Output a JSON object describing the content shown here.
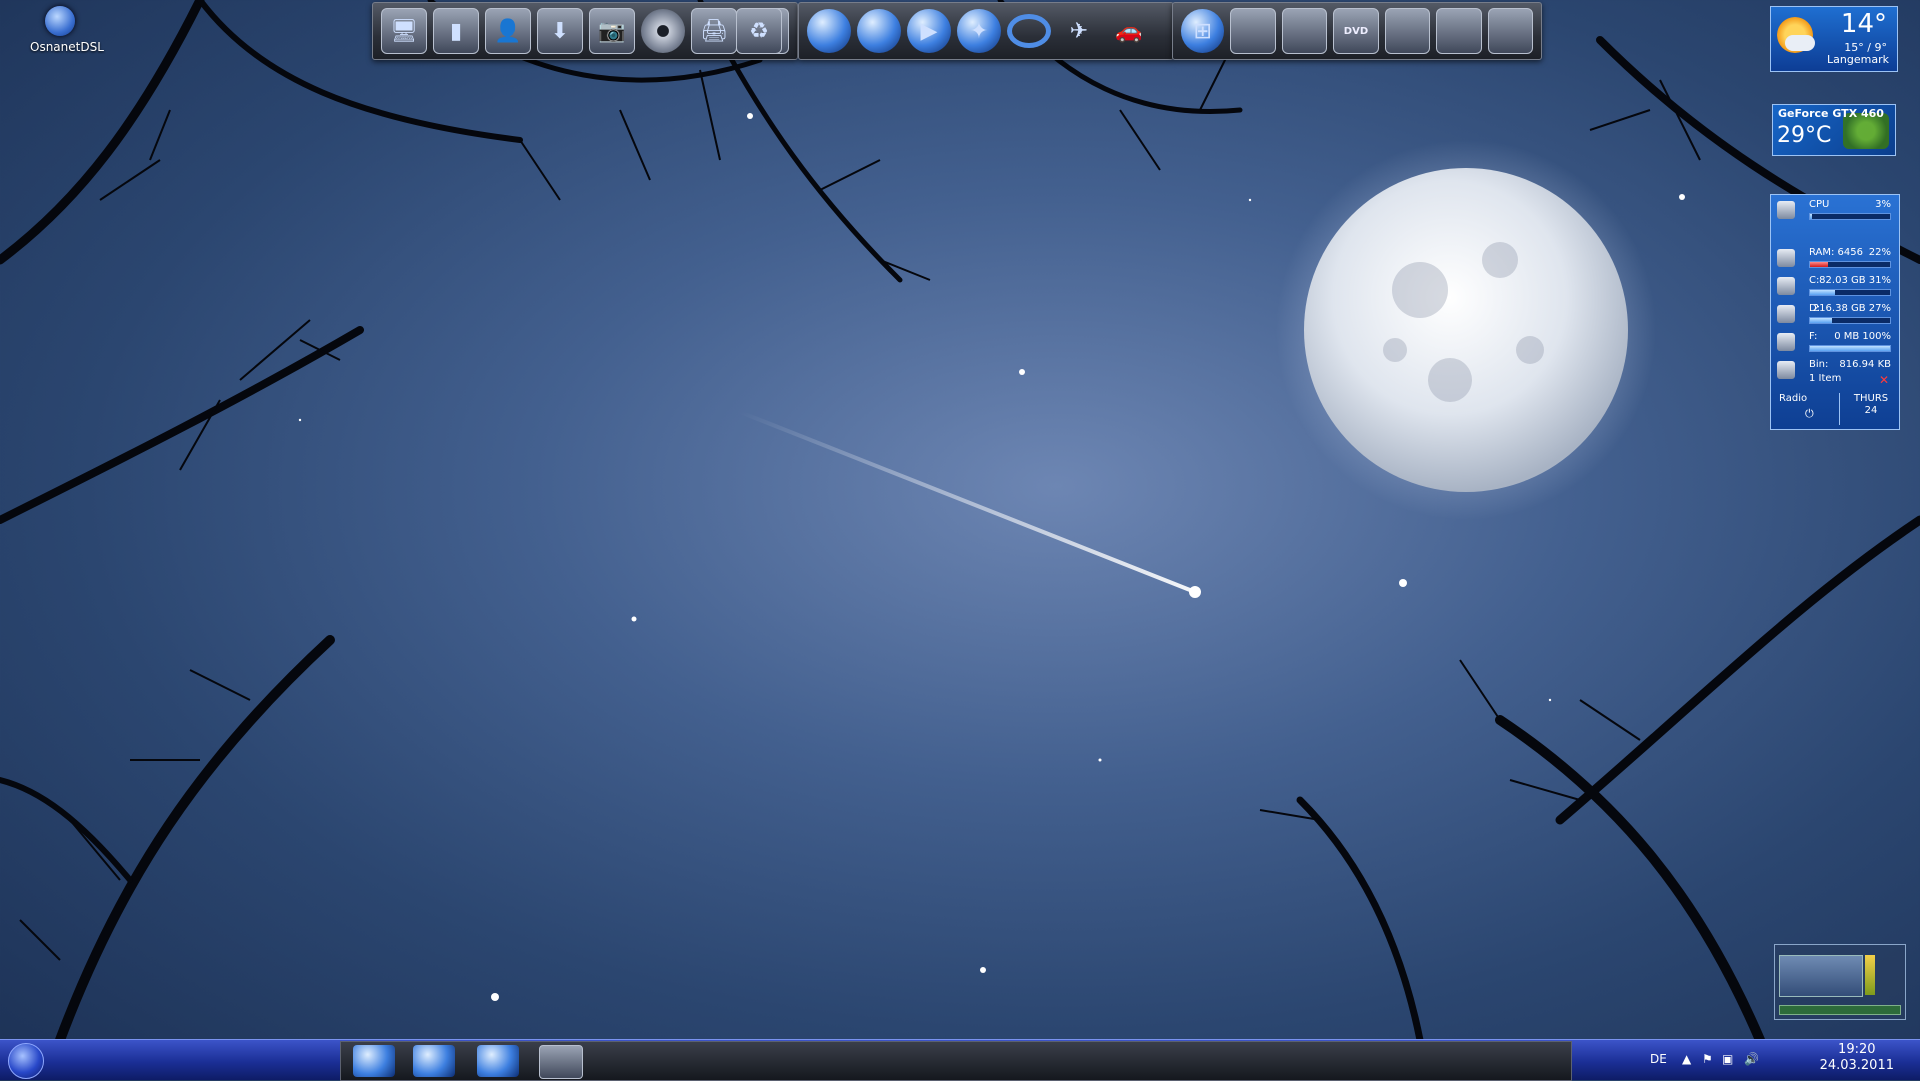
{
  "desktop": {
    "icons": [
      {
        "label": "OsnanetDSL"
      }
    ]
  },
  "dock": {
    "group1": [
      {
        "icon": "computer-icon"
      },
      {
        "icon": "folder-icon"
      },
      {
        "icon": "user-icon"
      },
      {
        "icon": "download-icon"
      },
      {
        "icon": "camera-icon"
      },
      {
        "icon": "disc-icon"
      },
      {
        "icon": "printer-icon"
      },
      {
        "icon": "network-icon"
      },
      {
        "icon": "recycle-bin-icon"
      }
    ],
    "group2": [
      {
        "icon": "browser-icon"
      },
      {
        "icon": "globe-icon"
      },
      {
        "icon": "media-player-icon"
      },
      {
        "icon": "clock-icon"
      },
      {
        "icon": "ring-icon"
      },
      {
        "icon": "starfighter-icon"
      },
      {
        "icon": "car-icon"
      }
    ],
    "group3": [
      {
        "icon": "windows-icon",
        "label": ""
      },
      {
        "icon": "drive-icon",
        "label": ""
      },
      {
        "icon": "drive-icon",
        "label": ""
      },
      {
        "icon": "dvd-icon",
        "label": "DVD"
      },
      {
        "icon": "drive-icon",
        "label": ""
      },
      {
        "icon": "bluray-icon",
        "label": ""
      },
      {
        "icon": "bluray-icon",
        "label": ""
      }
    ]
  },
  "weather": {
    "temp": "14°",
    "range": "15° / 9°",
    "city": "Langemark"
  },
  "gpu": {
    "name": "GeForce GTX 460",
    "temp": "29°C"
  },
  "sysmon": {
    "rows": [
      {
        "label": "CPU",
        "value": "3%",
        "fill": 0.03,
        "alert": false
      },
      {
        "label": "RAM: 6456",
        "value": "22%",
        "fill": 0.22,
        "alert": true
      },
      {
        "label": "C:",
        "value": "82.03 GB 31%",
        "fill": 0.31,
        "alert": false
      },
      {
        "label": "D:",
        "value": "216.38 GB 27%",
        "fill": 0.27,
        "alert": false
      },
      {
        "label": "F:",
        "value": "0 MB 100%",
        "fill": 1.0,
        "alert": false
      },
      {
        "label": "Bin:",
        "value": "816.94 KB",
        "fill": 0,
        "alert": false
      }
    ],
    "bin_items": "1 Item",
    "radio": "Radio",
    "day": "THURS",
    "date": "24"
  },
  "taskbar": {
    "language": "DE",
    "time": "19:20",
    "date": "24.03.2011",
    "tasks": [
      {
        "icon": "browser-icon"
      },
      {
        "icon": "globe-icon"
      },
      {
        "icon": "media-player-icon"
      },
      {
        "icon": "desktop-icon"
      }
    ]
  }
}
